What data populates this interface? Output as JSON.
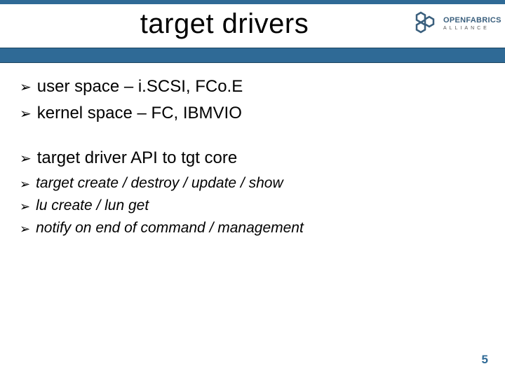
{
  "title": "target drivers",
  "logo": {
    "brand": "OPENFABRICS",
    "subline": "ALLIANCE"
  },
  "bullets": [
    {
      "text": "user space – i.SCSI, FCo.E"
    },
    {
      "text": "kernel space – FC, IBMVIO"
    }
  ],
  "bullets2": [
    {
      "text": "target driver API to tgt core"
    }
  ],
  "subbullets": [
    {
      "text": "target create / destroy / update / show"
    },
    {
      "text": "lu create / lun get"
    },
    {
      "text": "notify on end of command / management"
    }
  ],
  "pageNumber": "5"
}
